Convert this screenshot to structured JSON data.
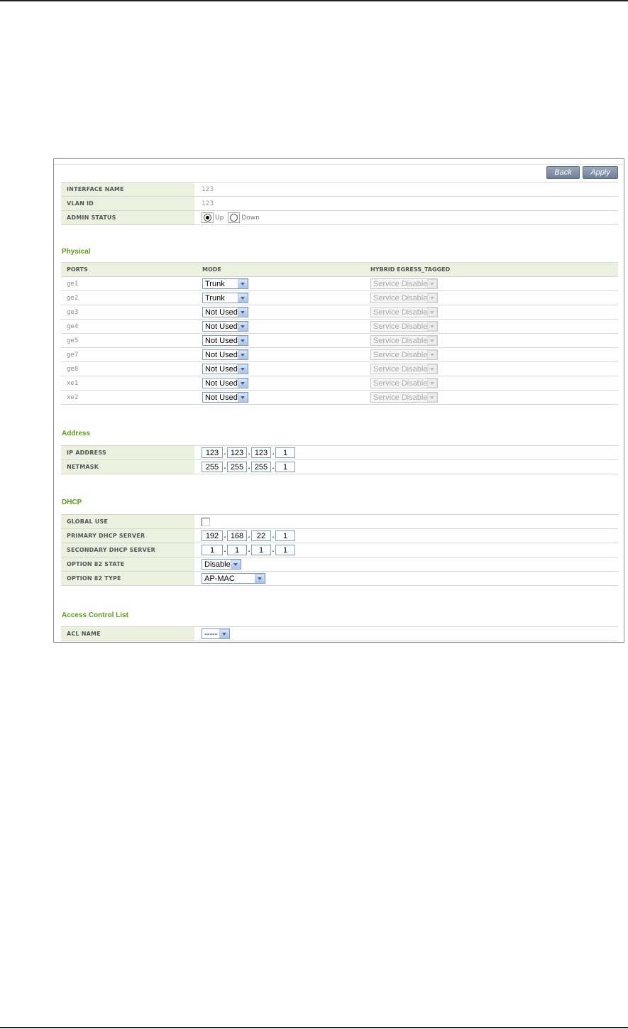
{
  "toolbar": {
    "back_label": "Back",
    "apply_label": "Apply"
  },
  "general": [
    {
      "label": "INTERFACE NAME",
      "value": "123"
    },
    {
      "label": "VLAN ID",
      "value": "123"
    },
    {
      "label": "ADMIN STATUS",
      "options": [
        "Up",
        "Down"
      ],
      "selected": "Up"
    }
  ],
  "physical": {
    "title": "Physical",
    "headers": [
      "PORTS",
      "MODE",
      "HYBRID EGRESS_TAGGED"
    ],
    "rows": [
      {
        "port": "ge1",
        "mode": "Trunk",
        "egress": "Service Disable"
      },
      {
        "port": "ge2",
        "mode": "Trunk",
        "egress": "Service Disable"
      },
      {
        "port": "ge3",
        "mode": "Not Used",
        "egress": "Service Disable"
      },
      {
        "port": "ge4",
        "mode": "Not Used",
        "egress": "Service Disable"
      },
      {
        "port": "ge5",
        "mode": "Not Used",
        "egress": "Service Disable"
      },
      {
        "port": "ge7",
        "mode": "Not Used",
        "egress": "Service Disable"
      },
      {
        "port": "ge8",
        "mode": "Not Used",
        "egress": "Service Disable"
      },
      {
        "port": "xe1",
        "mode": "Not Used",
        "egress": "Service Disable"
      },
      {
        "port": "xe2",
        "mode": "Not Used",
        "egress": "Service Disable"
      }
    ]
  },
  "address": {
    "title": "Address",
    "ip_label": "IP ADDRESS",
    "ip": [
      "123",
      "123",
      "123",
      "1"
    ],
    "netmask_label": "NETMASK",
    "netmask": [
      "255",
      "255",
      "255",
      "1"
    ]
  },
  "dhcp": {
    "title": "DHCP",
    "global_use_label": "GLOBAL USE",
    "global_use_checked": false,
    "primary_label": "PRIMARY DHCP SERVER",
    "primary": [
      "192",
      "168",
      "22",
      "1"
    ],
    "secondary_label": "SECONDARY DHCP SERVER",
    "secondary": [
      "1",
      "1",
      "1",
      "1"
    ],
    "option82_state_label": "OPTION 82 STATE",
    "option82_state": "Disable",
    "option82_type_label": "OPTION 82 TYPE",
    "option82_type": "AP-MAC"
  },
  "acl": {
    "title": "Access Control List",
    "name_label": "ACL NAME",
    "name_value": "-----"
  },
  "ip_dot": "."
}
